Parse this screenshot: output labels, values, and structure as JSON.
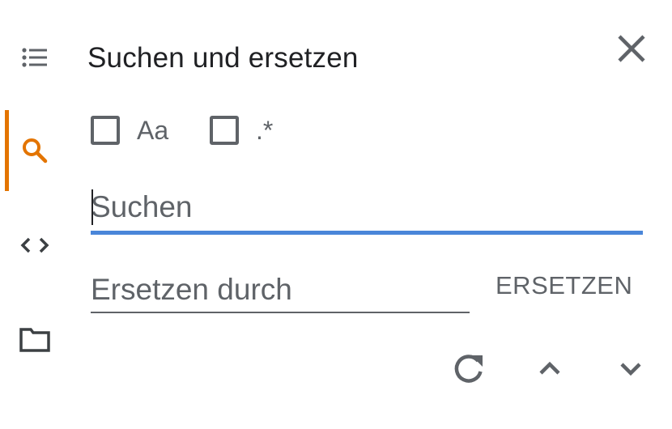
{
  "rail": {
    "items": [
      {
        "icon": "list-icon",
        "active": false
      },
      {
        "icon": "search-icon",
        "active": true
      },
      {
        "icon": "code-icon",
        "active": false
      },
      {
        "icon": "folder-icon",
        "active": false
      }
    ],
    "accent_color": "#e37400"
  },
  "panel": {
    "title": "Suchen und ersetzen",
    "close_icon": "close-icon"
  },
  "options": {
    "match_case": {
      "label": "Aa",
      "checked": false
    },
    "regex": {
      "label": ".*",
      "checked": false
    }
  },
  "search": {
    "value": "",
    "placeholder": "Suchen",
    "focus_color": "#4a86d9"
  },
  "replace": {
    "value": "",
    "placeholder": "Ersetzen durch",
    "button_label": "ERSETZEN"
  },
  "actions": {
    "refresh_icon": "refresh-icon",
    "previous_icon": "chevron-up-icon",
    "next_icon": "chevron-down-icon"
  }
}
